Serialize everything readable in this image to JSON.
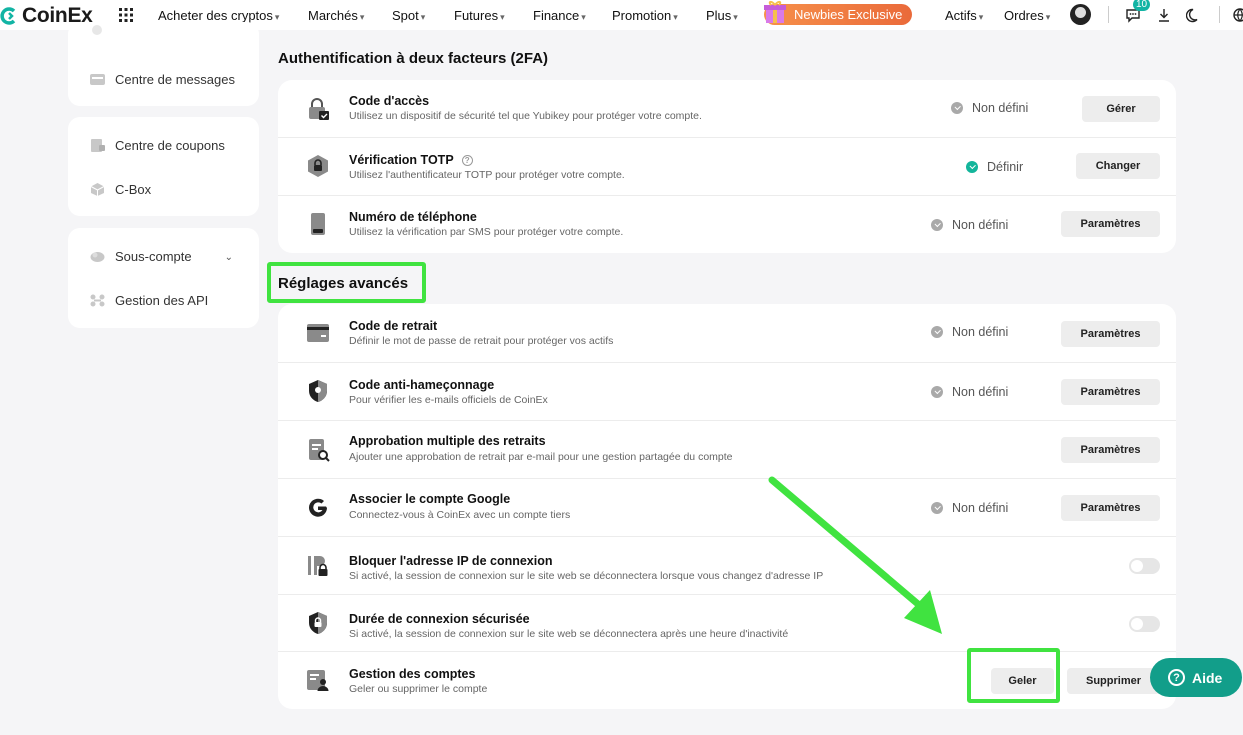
{
  "brand": "CoinEx",
  "nav": {
    "items": [
      "Acheter des cryptos",
      "Marchés",
      "Spot",
      "Futures",
      "Finance",
      "Promotion",
      "Plus"
    ],
    "promo": "Newbies Exclusive",
    "right_items": [
      "Actifs",
      "Ordres"
    ],
    "notif_count": "10"
  },
  "sidebar": {
    "messages": "Centre de messages",
    "coupons": "Centre de coupons",
    "cbox": "C-Box",
    "subaccount": "Sous-compte",
    "api": "Gestion des API"
  },
  "twofa": {
    "title": "Authentification à deux facteurs (2FA)",
    "rows": [
      {
        "title": "Code d'accès",
        "desc": "Utilisez un dispositif de sécurité tel que Yubikey pour protéger votre compte.",
        "status": "Non défini",
        "button": "Gérer"
      },
      {
        "title": "Vérification TOTP",
        "desc": "Utilisez l'authentificateur TOTP pour protéger votre compte.",
        "status": "Définir",
        "button": "Changer"
      },
      {
        "title": "Numéro de téléphone",
        "desc": "Utilisez la vérification par SMS pour protéger votre compte.",
        "status": "Non défini",
        "button": "Paramètres"
      }
    ]
  },
  "advanced": {
    "title": "Réglages avancés",
    "rows": [
      {
        "title": "Code de retrait",
        "desc": "Définir le mot de passe de retrait pour protéger vos actifs",
        "status": "Non défini",
        "button": "Paramètres"
      },
      {
        "title": "Code anti-hameçonnage",
        "desc": "Pour vérifier les e-mails officiels de CoinEx",
        "status": "Non défini",
        "button": "Paramètres"
      },
      {
        "title": "Approbation multiple des retraits",
        "desc": "Ajouter une approbation de retrait par e-mail pour une gestion partagée du compte",
        "button": "Paramètres"
      },
      {
        "title": "Associer le compte Google",
        "desc": "Connectez-vous à CoinEx avec un compte tiers",
        "status": "Non défini",
        "button": "Paramètres"
      },
      {
        "title": "Bloquer l'adresse IP de connexion",
        "desc": "Si activé, la session de connexion sur le site web se déconnectera lorsque vous changez d'adresse IP"
      },
      {
        "title": "Durée de connexion sécurisée",
        "desc": "Si activé, la session de connexion sur le site web se déconnectera après une heure d'inactivité"
      },
      {
        "title": "Gestion des comptes",
        "desc": "Geler ou supprimer le compte",
        "button_freeze": "Geler",
        "button_delete": "Supprimer"
      }
    ]
  },
  "help_label": "Aide",
  "colors": {
    "accent": "#12b4a4",
    "highlight": "#40e340",
    "promo": "#ef7a3f"
  }
}
